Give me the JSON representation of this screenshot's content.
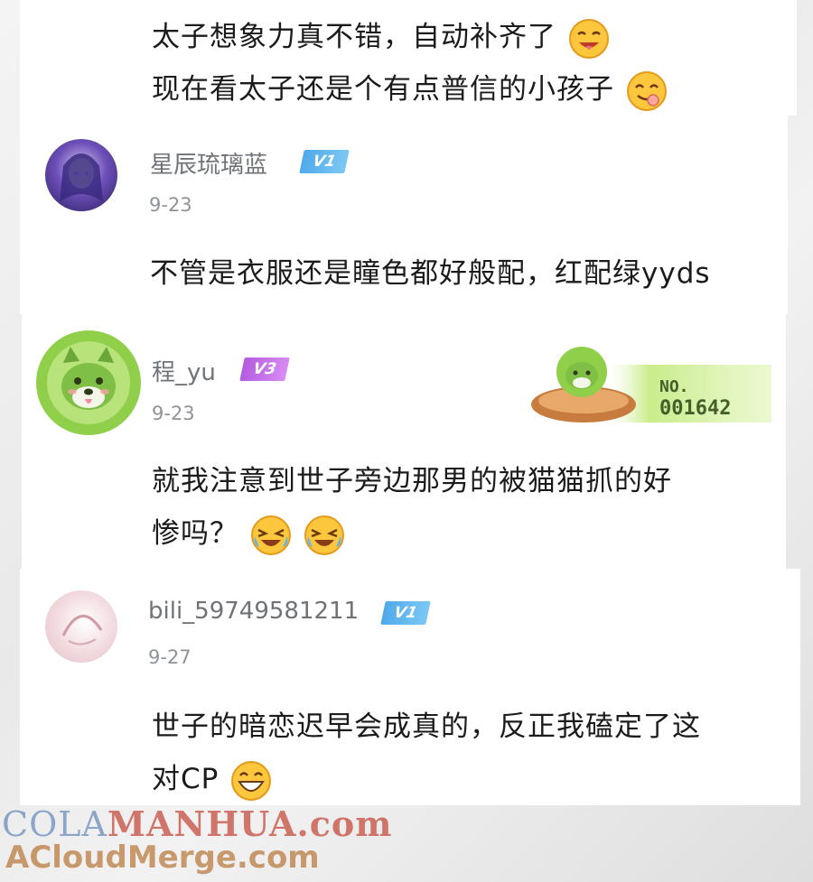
{
  "comments": [
    {
      "text_lines": [
        "太子想象力真不错，自动补齐了",
        "现在看太子还是个有点普信的小孩子"
      ]
    },
    {
      "username": "星辰琉璃蓝",
      "level": "V1",
      "date": "9-23",
      "text_lines": [
        "不管是衣服还是瞳色都好般配，红配绿yyds"
      ]
    },
    {
      "username": "程_yu",
      "level": "V3",
      "date": "9-23",
      "text_lines": [
        "就我注意到世子旁边那男的被猫猫抓的好",
        "惨吗？"
      ],
      "fan_badge": {
        "label": "NO.",
        "number": "001642"
      }
    },
    {
      "username": "bili_59749581211",
      "level": "V1",
      "date": "9-27",
      "text_lines": [
        "世子的暗恋迟早会成真的，反正我磕定了这",
        "对CP"
      ]
    }
  ],
  "watermark": {
    "line1_a": "COLA",
    "line1_b": "MANHUA.com",
    "line2": "ACloudMerge.com"
  },
  "colors": {
    "v1": "#4fa9ea",
    "v3": "#b35be0",
    "text": "#1b1b1b",
    "meta": "#8f9398"
  },
  "icons": [
    "drooling-emoji-icon",
    "yummy-emoji-icon",
    "laughing-crying-emoji-icon",
    "grinning-emoji-icon",
    "cabbage-dog-avatar",
    "fan-badge-icon"
  ]
}
